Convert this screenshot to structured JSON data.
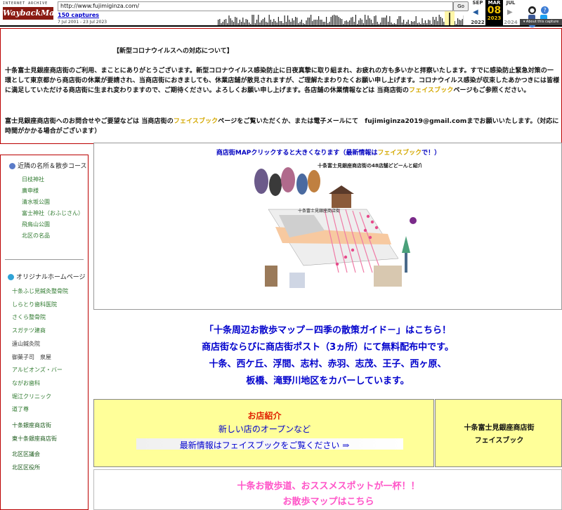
{
  "wayback": {
    "logo_small": "INTERNET ARCHIVE",
    "logo_main": "WaybackMachine",
    "url": "http://www.fujimiginza.com/",
    "go_label": "Go",
    "captures": "150 captures",
    "date_range": "7 Jul 2001 - 23 Jul 2023",
    "calendar": {
      "prev_month": "SEP",
      "cur_month": "MAR",
      "next_month": "JUL",
      "day": "08",
      "prev_year": "2022",
      "cur_year": "2023",
      "next_year": "2024"
    },
    "about": "▾ About this capture",
    "colors": {
      "bar": "#000000",
      "logo": "#8a1a12",
      "highlight": "#f3c300"
    }
  },
  "notice": {
    "title": "【新型コロナウイルスへの対応について】",
    "para1": "十条富士見銀座商店街のご利用、まことにありがとうございます。新型コロナウイルス感染防止に日夜真摯に取り組まれ、お疲れの方も多いかと拝察いたします。すでに感染防止緊急対策の一環として東京都から商店街の休業が要請され、当商店街におきましても、休業店舗が散見されますが、ご理解たまわりたくお願い申し上げます。コロナウイルス感染が収束したあかつきには皆様に満足していただける商店街に生まれ変わりますので、ご期待ください。よろしくお願い申し上げます。各店舗の休業情報などは 当商店街の",
    "para1_fb": "フェイスブック",
    "para1_end": "ページもご参照ください。",
    "para2_start": "富士見銀座商店街へのお問合せやご要望などは 当商店街の",
    "para2_fb": "フェイスブック",
    "para2_end": "ページをご覧いただくか、または電子メールにて　fujimiginza2019@gmail.comまでお願いいたします。（対応に時間がかかる場合がございます）"
  },
  "sidebar": {
    "section1_title": "近隣の名所＆散歩コース",
    "section1_links": [
      "日枝神社",
      "廣申様",
      "清水坂公園",
      "富士神社（おふじさん）",
      "飛鳥山公園",
      "北区の名品"
    ],
    "section2_title": "オリジナルホームページ",
    "section2_links": [
      "十条ふじ見鍼灸整骨院",
      "しらとり歯科医院",
      "さくら整骨院",
      "スガテツ建商",
      "遠山鍼灸院",
      "御菓子司　泉屋",
      "アルビオンズ・バー",
      "ながお歯科",
      "堀江クリニック",
      "道了尊",
      "十条銀座商店街",
      "東十条銀座商店街",
      "北区区議会",
      "北区区役所"
    ]
  },
  "main": {
    "map_caption_start": "商店街MAPクリックすると大きくなります（最新情報は",
    "map_caption_fb": "フェイスブック",
    "map_caption_end": "で！）",
    "map_image_title": "十条富士見銀座商店街の48店舗どどーんと紹介！",
    "map_image_sub": "十条富士見銀座商店街",
    "info_lines": [
      "「十条周辺お散歩マップ－四季の散策ガイド－」はこちら！",
      "商店街ならびに商店街ポスト（3ヵ所）にて無料配布中です。",
      "十条、西ケ丘、浮間、志村、赤羽、志茂、王子、西ヶ原、",
      "板橋、滝野川地区をカバーしています。"
    ],
    "shop_title": "お店紹介",
    "shop_line1": "新しい店のオープンなど",
    "shop_line2": "最新情報はフェイスブックをご覧ください ⇒",
    "right_box_l1": "十条富士見銀座商店街",
    "right_box_l2": "フェイスブック",
    "pink_l1": "十条お散歩道、おススメスポットが一杯！！",
    "pink_l2": "お散歩マップはこちら"
  }
}
